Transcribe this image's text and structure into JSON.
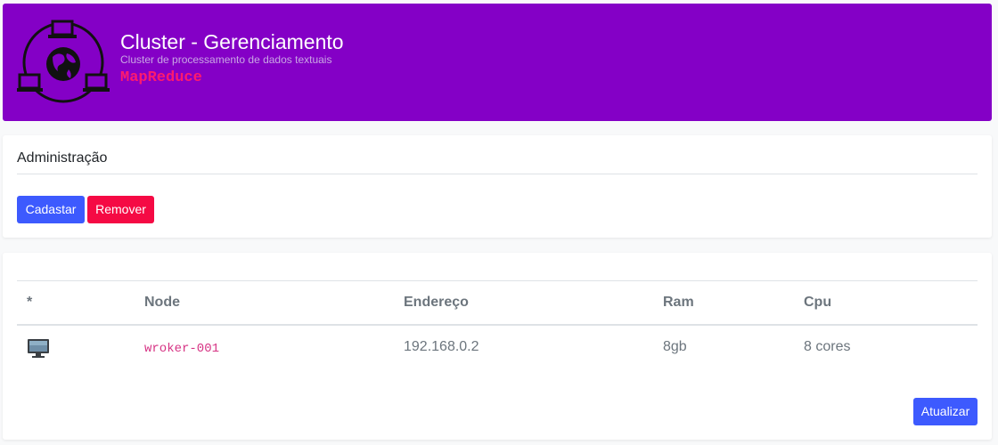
{
  "header": {
    "title": "Cluster - Gerenciamento",
    "subtitle": "Cluster de processamento de dados textuais",
    "tag": "MapReduce",
    "background": "#8400c6",
    "logo_icon": "network-globe-icon"
  },
  "admin": {
    "title": "Administração",
    "cadastrar_label": "Cadastar",
    "remover_label": "Remover"
  },
  "table": {
    "headers": [
      "*",
      "Node",
      "Endereço",
      "Ram",
      "Cpu"
    ],
    "rows": [
      {
        "icon": "computer-monitor-icon",
        "node": "wroker-001",
        "address": "192.168.0.2",
        "ram": "8gb",
        "cpu": "8 cores"
      }
    ],
    "refresh_label": "Atualizar"
  },
  "colors": {
    "primary": "#3d5afe",
    "danger": "#f50a44",
    "code": "#d63384"
  }
}
